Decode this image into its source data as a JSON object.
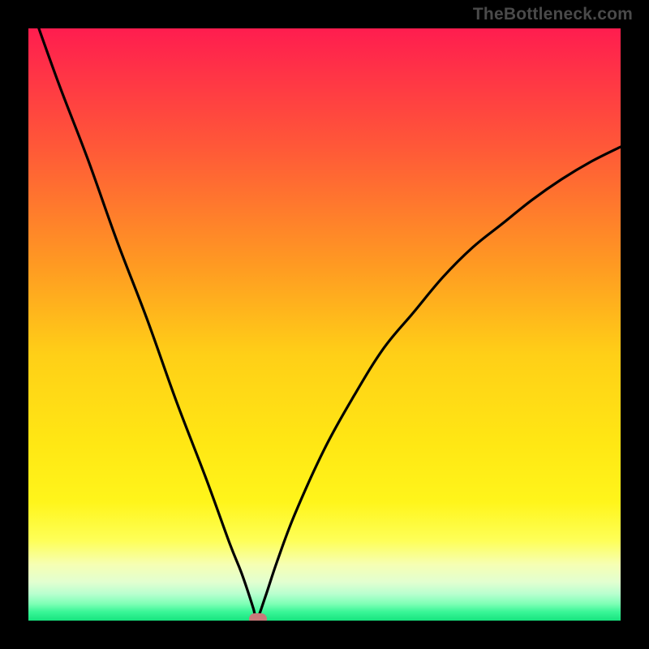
{
  "watermark": "TheBottleneck.com",
  "chart_data": {
    "type": "line",
    "title": "",
    "xlabel": "",
    "ylabel": "",
    "xlim": [
      0,
      100
    ],
    "ylim": [
      0,
      100
    ],
    "curve": {
      "type": "absolute-dip",
      "min_x": 38.5,
      "min_y": 0,
      "points_x": [
        0,
        5,
        10,
        15,
        20,
        25,
        30,
        34,
        36,
        38,
        38.5,
        40,
        42,
        45,
        50,
        55,
        60,
        65,
        70,
        75,
        80,
        85,
        90,
        95,
        100
      ],
      "points_y": [
        105,
        91,
        78,
        64,
        51,
        37,
        24,
        13,
        8,
        2,
        0,
        4,
        10,
        18,
        29,
        38,
        46,
        52,
        58,
        63,
        67,
        71,
        74.5,
        77.5,
        80
      ]
    },
    "marker": {
      "x": 38.7,
      "y": 0.3,
      "color": "#c97a7a"
    },
    "gradient_stops": [
      {
        "pos": 0.0,
        "color": "#ff1d4f"
      },
      {
        "pos": 0.2,
        "color": "#ff5838"
      },
      {
        "pos": 0.4,
        "color": "#ff9a22"
      },
      {
        "pos": 0.55,
        "color": "#ffcf17"
      },
      {
        "pos": 0.7,
        "color": "#ffe714"
      },
      {
        "pos": 0.8,
        "color": "#fff51b"
      },
      {
        "pos": 0.865,
        "color": "#feff58"
      },
      {
        "pos": 0.905,
        "color": "#f6ffb3"
      },
      {
        "pos": 0.935,
        "color": "#e2ffd0"
      },
      {
        "pos": 0.955,
        "color": "#b8ffcf"
      },
      {
        "pos": 0.972,
        "color": "#7dffb5"
      },
      {
        "pos": 0.985,
        "color": "#3af697"
      },
      {
        "pos": 1.0,
        "color": "#17e47f"
      }
    ]
  }
}
